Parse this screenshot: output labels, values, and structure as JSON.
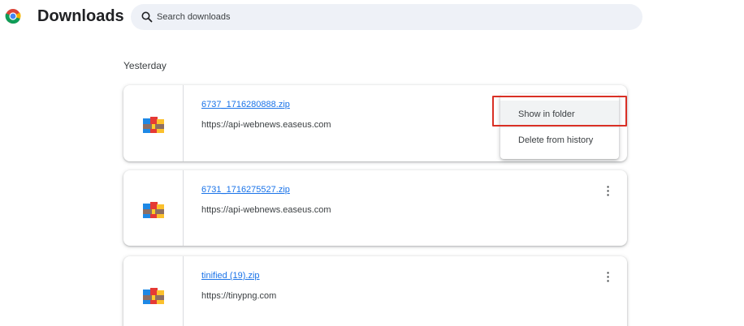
{
  "app": {
    "title": "Downloads",
    "logo_icon": "chrome-logo-icon"
  },
  "search": {
    "placeholder": "Search downloads",
    "value": "",
    "icon": "search-icon"
  },
  "section": {
    "heading": "Yesterday"
  },
  "downloads": [
    {
      "file_name": "6737_1716280888.zip",
      "url": "https://api-webnews.easeus.com",
      "icon": "winrar-archive-icon"
    },
    {
      "file_name": "6731_1716275527.zip",
      "url": "https://api-webnews.easeus.com",
      "icon": "winrar-archive-icon"
    },
    {
      "file_name": "tinified (19).zip",
      "url": "https://tinypng.com",
      "icon": "winrar-archive-icon"
    }
  ],
  "context_menu": {
    "items": [
      {
        "label": "Show in folder",
        "highlighted": true
      },
      {
        "label": "Delete from history",
        "highlighted": false
      }
    ]
  },
  "colors": {
    "link": "#1a73e8",
    "highlight_border": "#d93025",
    "search_bg": "#eef1f7"
  }
}
